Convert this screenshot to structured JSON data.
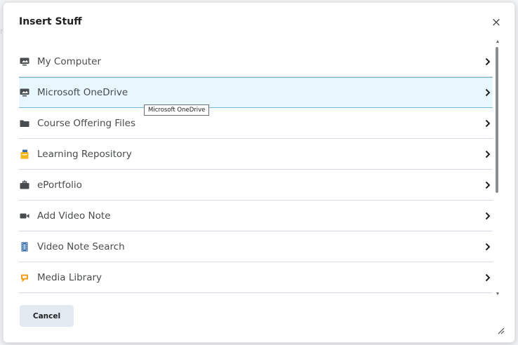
{
  "dialog": {
    "title": "Insert Stuff",
    "close_label": "×",
    "cancel_label": "Cancel"
  },
  "items": [
    {
      "label": "My Computer",
      "icon": "monitor-icon"
    },
    {
      "label": "Microsoft OneDrive",
      "icon": "monitor-icon",
      "highlighted": true
    },
    {
      "label": "Course Offering Files",
      "icon": "folder-icon"
    },
    {
      "label": "Learning Repository",
      "icon": "repository-icon"
    },
    {
      "label": "ePortfolio",
      "icon": "briefcase-icon"
    },
    {
      "label": "Add Video Note",
      "icon": "video-camera-icon"
    },
    {
      "label": "Video Note Search",
      "icon": "film-strip-icon"
    },
    {
      "label": "Media Library",
      "icon": "media-library-icon"
    }
  ],
  "tooltip": {
    "text": "Microsoft OneDrive"
  },
  "colors": {
    "highlight_bg": "#e8f7fd",
    "highlight_border": "#6fb6d9",
    "cancel_bg": "#e3e9f1",
    "learning_repository_icon": "#f2b51b",
    "media_library_icon": "#f29e1b",
    "film_strip_icon": "#3a6ea5"
  }
}
